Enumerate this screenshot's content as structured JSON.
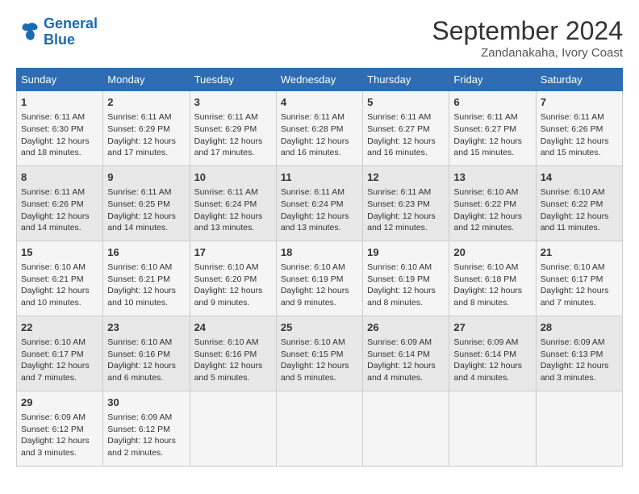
{
  "header": {
    "logo_line1": "General",
    "logo_line2": "Blue",
    "month": "September 2024",
    "location": "Zandanakaha, Ivory Coast"
  },
  "weekdays": [
    "Sunday",
    "Monday",
    "Tuesday",
    "Wednesday",
    "Thursday",
    "Friday",
    "Saturday"
  ],
  "weeks": [
    [
      {
        "day": "1",
        "lines": [
          "Sunrise: 6:11 AM",
          "Sunset: 6:30 PM",
          "Daylight: 12 hours",
          "and 18 minutes."
        ]
      },
      {
        "day": "2",
        "lines": [
          "Sunrise: 6:11 AM",
          "Sunset: 6:29 PM",
          "Daylight: 12 hours",
          "and 17 minutes."
        ]
      },
      {
        "day": "3",
        "lines": [
          "Sunrise: 6:11 AM",
          "Sunset: 6:29 PM",
          "Daylight: 12 hours",
          "and 17 minutes."
        ]
      },
      {
        "day": "4",
        "lines": [
          "Sunrise: 6:11 AM",
          "Sunset: 6:28 PM",
          "Daylight: 12 hours",
          "and 16 minutes."
        ]
      },
      {
        "day": "5",
        "lines": [
          "Sunrise: 6:11 AM",
          "Sunset: 6:27 PM",
          "Daylight: 12 hours",
          "and 16 minutes."
        ]
      },
      {
        "day": "6",
        "lines": [
          "Sunrise: 6:11 AM",
          "Sunset: 6:27 PM",
          "Daylight: 12 hours",
          "and 15 minutes."
        ]
      },
      {
        "day": "7",
        "lines": [
          "Sunrise: 6:11 AM",
          "Sunset: 6:26 PM",
          "Daylight: 12 hours",
          "and 15 minutes."
        ]
      }
    ],
    [
      {
        "day": "8",
        "lines": [
          "Sunrise: 6:11 AM",
          "Sunset: 6:26 PM",
          "Daylight: 12 hours",
          "and 14 minutes."
        ]
      },
      {
        "day": "9",
        "lines": [
          "Sunrise: 6:11 AM",
          "Sunset: 6:25 PM",
          "Daylight: 12 hours",
          "and 14 minutes."
        ]
      },
      {
        "day": "10",
        "lines": [
          "Sunrise: 6:11 AM",
          "Sunset: 6:24 PM",
          "Daylight: 12 hours",
          "and 13 minutes."
        ]
      },
      {
        "day": "11",
        "lines": [
          "Sunrise: 6:11 AM",
          "Sunset: 6:24 PM",
          "Daylight: 12 hours",
          "and 13 minutes."
        ]
      },
      {
        "day": "12",
        "lines": [
          "Sunrise: 6:11 AM",
          "Sunset: 6:23 PM",
          "Daylight: 12 hours",
          "and 12 minutes."
        ]
      },
      {
        "day": "13",
        "lines": [
          "Sunrise: 6:10 AM",
          "Sunset: 6:22 PM",
          "Daylight: 12 hours",
          "and 12 minutes."
        ]
      },
      {
        "day": "14",
        "lines": [
          "Sunrise: 6:10 AM",
          "Sunset: 6:22 PM",
          "Daylight: 12 hours",
          "and 11 minutes."
        ]
      }
    ],
    [
      {
        "day": "15",
        "lines": [
          "Sunrise: 6:10 AM",
          "Sunset: 6:21 PM",
          "Daylight: 12 hours",
          "and 10 minutes."
        ]
      },
      {
        "day": "16",
        "lines": [
          "Sunrise: 6:10 AM",
          "Sunset: 6:21 PM",
          "Daylight: 12 hours",
          "and 10 minutes."
        ]
      },
      {
        "day": "17",
        "lines": [
          "Sunrise: 6:10 AM",
          "Sunset: 6:20 PM",
          "Daylight: 12 hours",
          "and 9 minutes."
        ]
      },
      {
        "day": "18",
        "lines": [
          "Sunrise: 6:10 AM",
          "Sunset: 6:19 PM",
          "Daylight: 12 hours",
          "and 9 minutes."
        ]
      },
      {
        "day": "19",
        "lines": [
          "Sunrise: 6:10 AM",
          "Sunset: 6:19 PM",
          "Daylight: 12 hours",
          "and 8 minutes."
        ]
      },
      {
        "day": "20",
        "lines": [
          "Sunrise: 6:10 AM",
          "Sunset: 6:18 PM",
          "Daylight: 12 hours",
          "and 8 minutes."
        ]
      },
      {
        "day": "21",
        "lines": [
          "Sunrise: 6:10 AM",
          "Sunset: 6:17 PM",
          "Daylight: 12 hours",
          "and 7 minutes."
        ]
      }
    ],
    [
      {
        "day": "22",
        "lines": [
          "Sunrise: 6:10 AM",
          "Sunset: 6:17 PM",
          "Daylight: 12 hours",
          "and 7 minutes."
        ]
      },
      {
        "day": "23",
        "lines": [
          "Sunrise: 6:10 AM",
          "Sunset: 6:16 PM",
          "Daylight: 12 hours",
          "and 6 minutes."
        ]
      },
      {
        "day": "24",
        "lines": [
          "Sunrise: 6:10 AM",
          "Sunset: 6:16 PM",
          "Daylight: 12 hours",
          "and 5 minutes."
        ]
      },
      {
        "day": "25",
        "lines": [
          "Sunrise: 6:10 AM",
          "Sunset: 6:15 PM",
          "Daylight: 12 hours",
          "and 5 minutes."
        ]
      },
      {
        "day": "26",
        "lines": [
          "Sunrise: 6:09 AM",
          "Sunset: 6:14 PM",
          "Daylight: 12 hours",
          "and 4 minutes."
        ]
      },
      {
        "day": "27",
        "lines": [
          "Sunrise: 6:09 AM",
          "Sunset: 6:14 PM",
          "Daylight: 12 hours",
          "and 4 minutes."
        ]
      },
      {
        "day": "28",
        "lines": [
          "Sunrise: 6:09 AM",
          "Sunset: 6:13 PM",
          "Daylight: 12 hours",
          "and 3 minutes."
        ]
      }
    ],
    [
      {
        "day": "29",
        "lines": [
          "Sunrise: 6:09 AM",
          "Sunset: 6:12 PM",
          "Daylight: 12 hours",
          "and 3 minutes."
        ]
      },
      {
        "day": "30",
        "lines": [
          "Sunrise: 6:09 AM",
          "Sunset: 6:12 PM",
          "Daylight: 12 hours",
          "and 2 minutes."
        ]
      },
      {
        "day": "",
        "lines": []
      },
      {
        "day": "",
        "lines": []
      },
      {
        "day": "",
        "lines": []
      },
      {
        "day": "",
        "lines": []
      },
      {
        "day": "",
        "lines": []
      }
    ]
  ]
}
